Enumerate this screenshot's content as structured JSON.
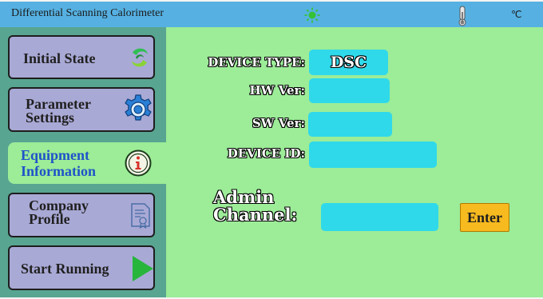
{
  "window": {
    "title": "Differential Scanning Calorimeter",
    "temperature_unit": "℃",
    "status_icon": "sun-icon",
    "thermometer_icon": "thermometer-icon"
  },
  "sidebar": {
    "items": [
      {
        "label": "Initial State",
        "icon": "refresh-swirl-icon",
        "active": false
      },
      {
        "label": "Parameter\nSettings",
        "icon": "gear-icon",
        "active": false
      },
      {
        "label": "Equipment\nInformation",
        "icon": "info-icon",
        "active": true
      },
      {
        "label": "Company\nProfile",
        "icon": "certificate-icon",
        "active": false
      },
      {
        "label": "Start Running",
        "icon": "play-icon",
        "active": false
      }
    ]
  },
  "info": {
    "device_type_label": "DEVICE TYPE:",
    "device_type_value": "DSC",
    "hw_ver_label": "HW Ver:",
    "hw_ver_value": "",
    "sw_ver_label": "SW Ver:",
    "sw_ver_value": "",
    "device_id_label": "DEVICE ID:",
    "device_id_value": "",
    "admin_label": "Admin\nChannel:",
    "admin_value": "",
    "enter_label": "Enter"
  },
  "colors": {
    "title_bar": "#56b1e2",
    "sidebar_bg": "#58a591",
    "panel_bg": "#9cec98",
    "nav_button": "#a9a9d6",
    "field_box": "#2fd9ea",
    "active_label": "#1f53c9",
    "enter_button": "#f7ba1f"
  }
}
